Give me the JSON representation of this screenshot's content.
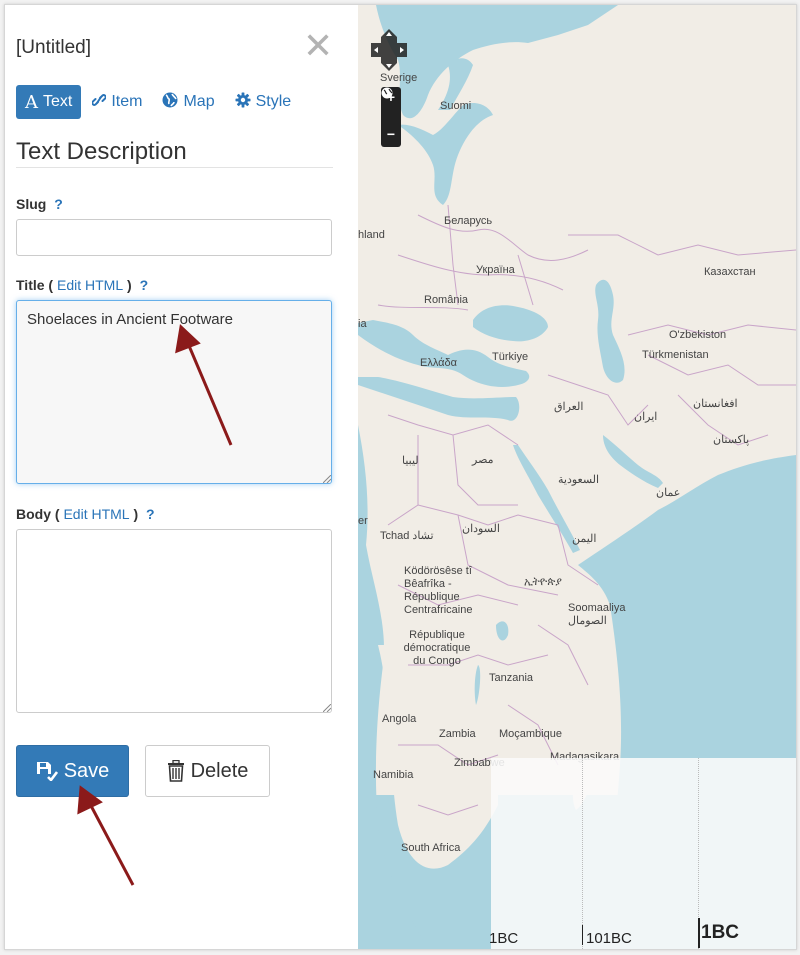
{
  "panel": {
    "title": "[Untitled]",
    "close_glyph": "✕",
    "tabs": [
      {
        "label": "Text",
        "icon": "text-A-icon",
        "active": true
      },
      {
        "label": "Item",
        "icon": "link-icon",
        "active": false
      },
      {
        "label": "Map",
        "icon": "globe-icon",
        "active": false
      },
      {
        "label": "Style",
        "icon": "gear-icon",
        "active": false
      }
    ],
    "section_title": "Text Description",
    "slug": {
      "label": "Slug",
      "help": "?",
      "value": ""
    },
    "title_field": {
      "label": "Title",
      "open_paren": "(",
      "edit_html": "Edit HTML",
      "close_paren": ")",
      "help": "?",
      "value": "Shoelaces in Ancient Footware"
    },
    "body_field": {
      "label": "Body",
      "open_paren": "(",
      "edit_html": "Edit HTML",
      "close_paren": ")",
      "help": "?",
      "value": ""
    },
    "save_label": "Save",
    "delete_label": "Delete"
  },
  "map": {
    "labels": [
      "Sverige",
      "Suomi",
      "Беларусь",
      "hland",
      "Україна",
      "Казахстан",
      "România",
      "Ελλάδα",
      "Türkiye",
      "O'zbekiston",
      "Türkmenistan",
      "ia",
      "العراق",
      "ایران",
      "افغانستان",
      "پاکستان",
      "ليبيا",
      "مصر",
      "السعودية",
      "عمان",
      "Tchad تشاد",
      "السودان",
      "er",
      "اليمن",
      "Ködörösêse tî Bêafrîka - République Centrafricaine",
      "ኢትዮጵያ",
      "Soomaaliya الصومال",
      "République démocratique du Congo",
      "Tanzania",
      "Angola",
      "Zambia",
      "Moçambique",
      "Madagasikara",
      "Namibia",
      "Zimbabwe",
      "South Africa"
    ],
    "controls": {
      "zoom_in": "+",
      "zoom_out": "−"
    },
    "colors": {
      "sea": "#aad3df",
      "land": "#f1ede6",
      "border": "#c9a5c9"
    }
  },
  "timeline": {
    "labels": [
      "1BC",
      "101BC",
      "1BC"
    ]
  }
}
